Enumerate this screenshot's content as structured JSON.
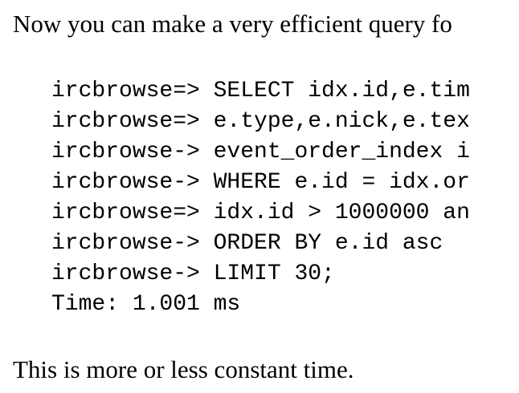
{
  "intro_text": "Now you can make a very efficient query fo",
  "code_lines": [
    "ircbrowse=> SELECT idx.id,e.tim",
    "ircbrowse=> e.type,e.nick,e.tex",
    "ircbrowse-> event_order_index i",
    "ircbrowse-> WHERE e.id = idx.or",
    "ircbrowse=> idx.id > 1000000 an",
    "ircbrowse-> ORDER BY e.id asc",
    "ircbrowse-> LIMIT 30;",
    "Time: 1.001 ms"
  ],
  "outro_text": "This is more or less constant time."
}
